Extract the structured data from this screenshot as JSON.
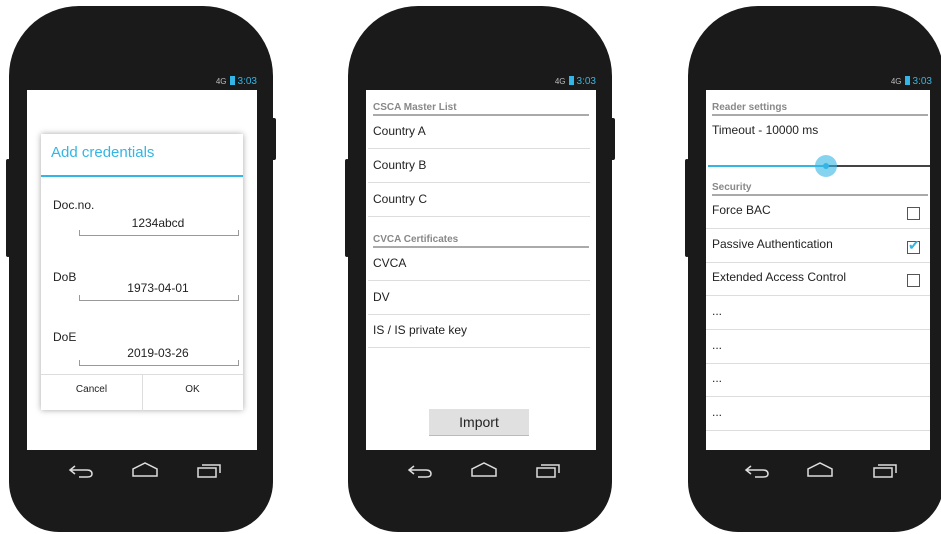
{
  "status": {
    "network": "4G",
    "time": "3:03"
  },
  "colors": {
    "accent": "#33b5e5"
  },
  "nav_icons": [
    "back-icon",
    "home-icon",
    "recent-apps-icon"
  ],
  "screen1": {
    "dialog_title": "Add credentials",
    "fields": [
      {
        "label": "Doc.no.",
        "value": "1234abcd"
      },
      {
        "label": "DoB",
        "value": "1973-04-01"
      },
      {
        "label": "DoE",
        "value": "2019-03-26"
      }
    ],
    "cancel_label": "Cancel",
    "ok_label": "OK"
  },
  "screen2": {
    "csca_header": "CSCA Master List",
    "csca_items": [
      "Country A",
      "Country B",
      "Country C"
    ],
    "cvca_header": "CVCA Certificates",
    "cvca_items": [
      "CVCA",
      "DV",
      "IS / IS private key"
    ],
    "import_label": "Import"
  },
  "screen3": {
    "reader_header": "Reader settings",
    "timeout_label": "Timeout - 10000 ms",
    "timeout_slider_fraction": 0.53,
    "security_header": "Security",
    "options": [
      {
        "label": "Force BAC",
        "checked": false
      },
      {
        "label": "Passive Authentication",
        "checked": true
      },
      {
        "label": "Extended Access Control",
        "checked": false
      }
    ],
    "more_items": [
      "...",
      "...",
      "...",
      "..."
    ]
  }
}
